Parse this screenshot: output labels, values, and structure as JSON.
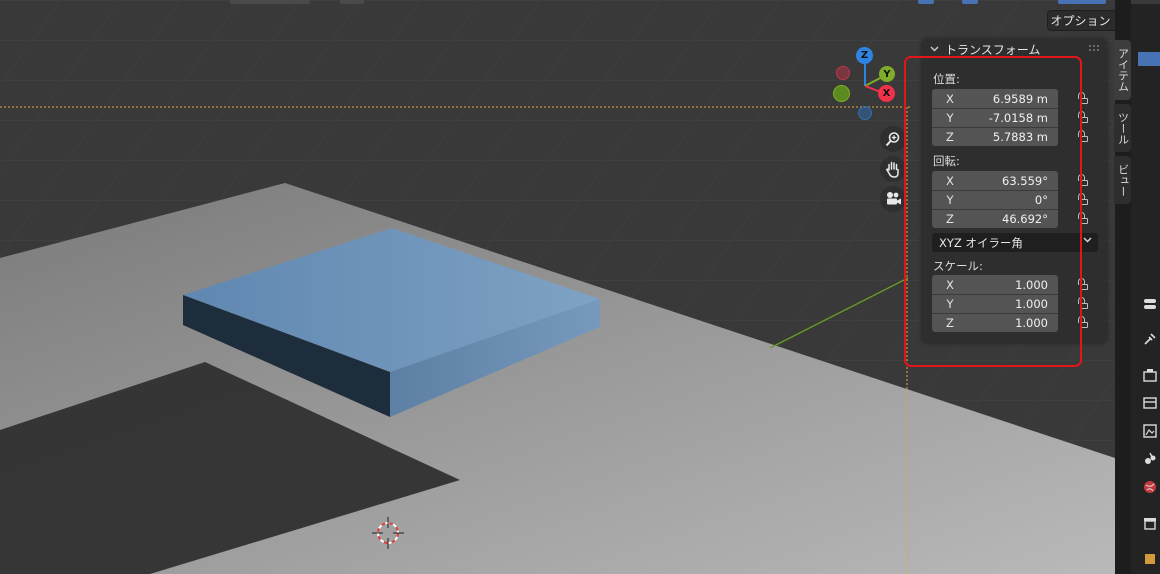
{
  "header": {
    "options_label": "オプション"
  },
  "panel": {
    "title": "トランスフォーム",
    "location": {
      "label": "位置:",
      "x": {
        "axis": "X",
        "value": "6.9589 m"
      },
      "y": {
        "axis": "Y",
        "value": "-7.0158 m"
      },
      "z": {
        "axis": "Z",
        "value": "5.7883 m"
      }
    },
    "rotation": {
      "label": "回転:",
      "x": {
        "axis": "X",
        "value": "63.559°"
      },
      "y": {
        "axis": "Y",
        "value": "0°"
      },
      "z": {
        "axis": "Z",
        "value": "46.692°"
      },
      "mode": "XYZ オイラー角"
    },
    "scale": {
      "label": "スケール:",
      "x": {
        "axis": "X",
        "value": "1.000"
      },
      "y": {
        "axis": "Y",
        "value": "1.000"
      },
      "z": {
        "axis": "Z",
        "value": "1.000"
      }
    }
  },
  "tabs": {
    "item": "アイテム",
    "tool": "ツール",
    "view": "ビュー"
  },
  "gizmo": {
    "z": "Z",
    "y": "Y",
    "x": "X"
  },
  "colors": {
    "x_axis": "#f0324b",
    "y_axis": "#7fad28",
    "z_axis": "#2f83e3",
    "highlight": "#e0161b",
    "cube": "#6e93b8"
  }
}
